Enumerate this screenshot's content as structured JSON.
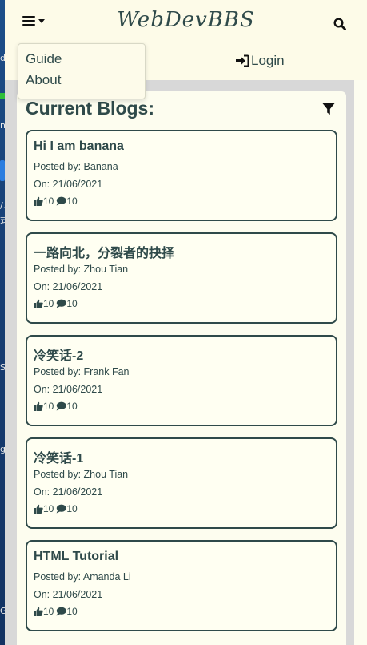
{
  "desktop": {
    "chars": [
      "de",
      "n",
      "/...",
      "式",
      "S",
      "g",
      "G"
    ]
  },
  "navbar": {
    "brand": "WebDevBBS",
    "menu_icon": "hamburger-icon",
    "search_icon": "search-icon"
  },
  "dropdown": {
    "items": [
      "Guide",
      "About"
    ]
  },
  "login": {
    "label": "Login",
    "icon": "sign-in-icon"
  },
  "main": {
    "title": "Current Blogs:",
    "filter_icon": "filter-icon",
    "posted_by_prefix": "Posted by: ",
    "on_prefix": "On: ",
    "blogs": [
      {
        "title": "Hi I am banana",
        "author": "Banana",
        "date": "21/06/2021",
        "likes": "10",
        "comments": "10"
      },
      {
        "title": "一路向北，分裂者的抉择",
        "author": "Zhou Tian",
        "date": "21/06/2021",
        "likes": "10",
        "comments": "10"
      },
      {
        "title": "冷笑话-2",
        "author": "Frank Fan",
        "date": "21/06/2021",
        "likes": "10",
        "comments": "10"
      },
      {
        "title": "冷笑话-1",
        "author": "Zhou Tian",
        "date": "21/06/2021",
        "likes": "10",
        "comments": "10"
      },
      {
        "title": "HTML Tutorial",
        "author": "Amanda Li",
        "date": "21/06/2021",
        "likes": "10",
        "comments": "10"
      }
    ]
  },
  "colors": {
    "accent": "#2f4a4a",
    "background": "#fdfdef",
    "content_bg": "#d8d8d8"
  }
}
